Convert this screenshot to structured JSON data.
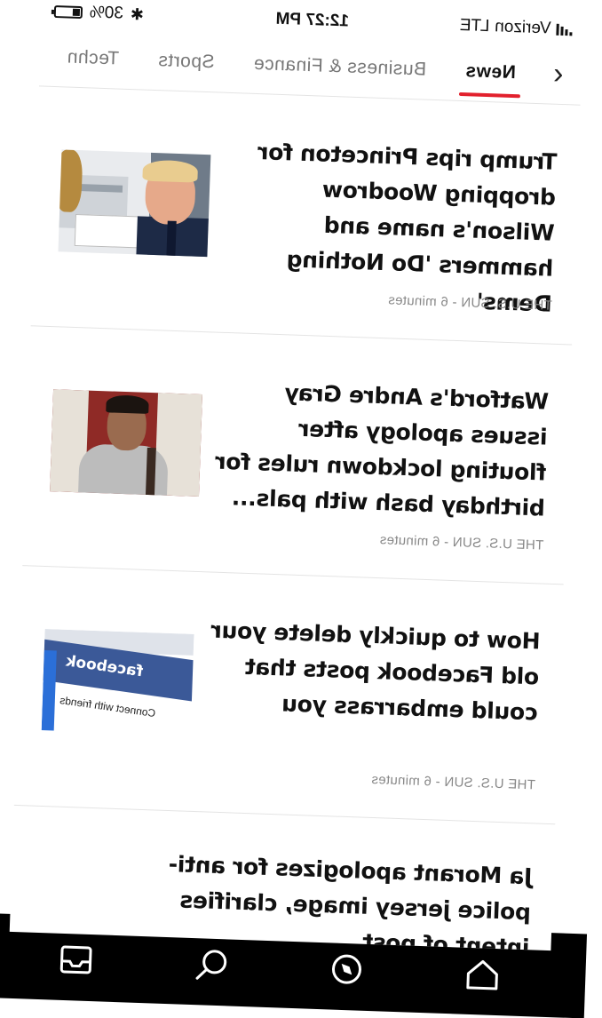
{
  "status_bar": {
    "carrier": "Verizon",
    "network": "LTE",
    "time": "12:27 PM",
    "battery_percent": "30%",
    "battery_level": 0.3
  },
  "tabs": [
    {
      "label": "News",
      "active": true
    },
    {
      "label": "Business & Finance",
      "active": false
    },
    {
      "label": "Sports",
      "active": false
    },
    {
      "label": "Techn",
      "active": false
    }
  ],
  "articles": [
    {
      "headline": "Trump rips Princeton for dropping Woodrow Wilson's name and hammers 'Do Nothing Dems'",
      "source": "THE U.S. SUN",
      "age": "6 minutes"
    },
    {
      "headline": "Watford's Andre Gray issues apology after flouting lockdown rules for birthday bash with pals...",
      "source": "THE U.S. SUN",
      "age": "6 minutes"
    },
    {
      "headline": "How to quickly delete your old Facebook posts that could embarrass you",
      "source": "THE U.S. SUN",
      "age": "6 minutes"
    },
    {
      "headline": "Ja Morant apologizes for anti-police jersey image, clarifies intent of post"
    }
  ],
  "thumbnail_texts": {
    "facebook_logo": "facebook",
    "facebook_tagline": "Connect with friends"
  },
  "bottom_nav": [
    {
      "name": "home-icon"
    },
    {
      "name": "discover-icon"
    },
    {
      "name": "search-icon"
    },
    {
      "name": "inbox-icon"
    }
  ],
  "colors": {
    "accent": "#e2212d",
    "text": "#111111",
    "meta": "#888888"
  }
}
